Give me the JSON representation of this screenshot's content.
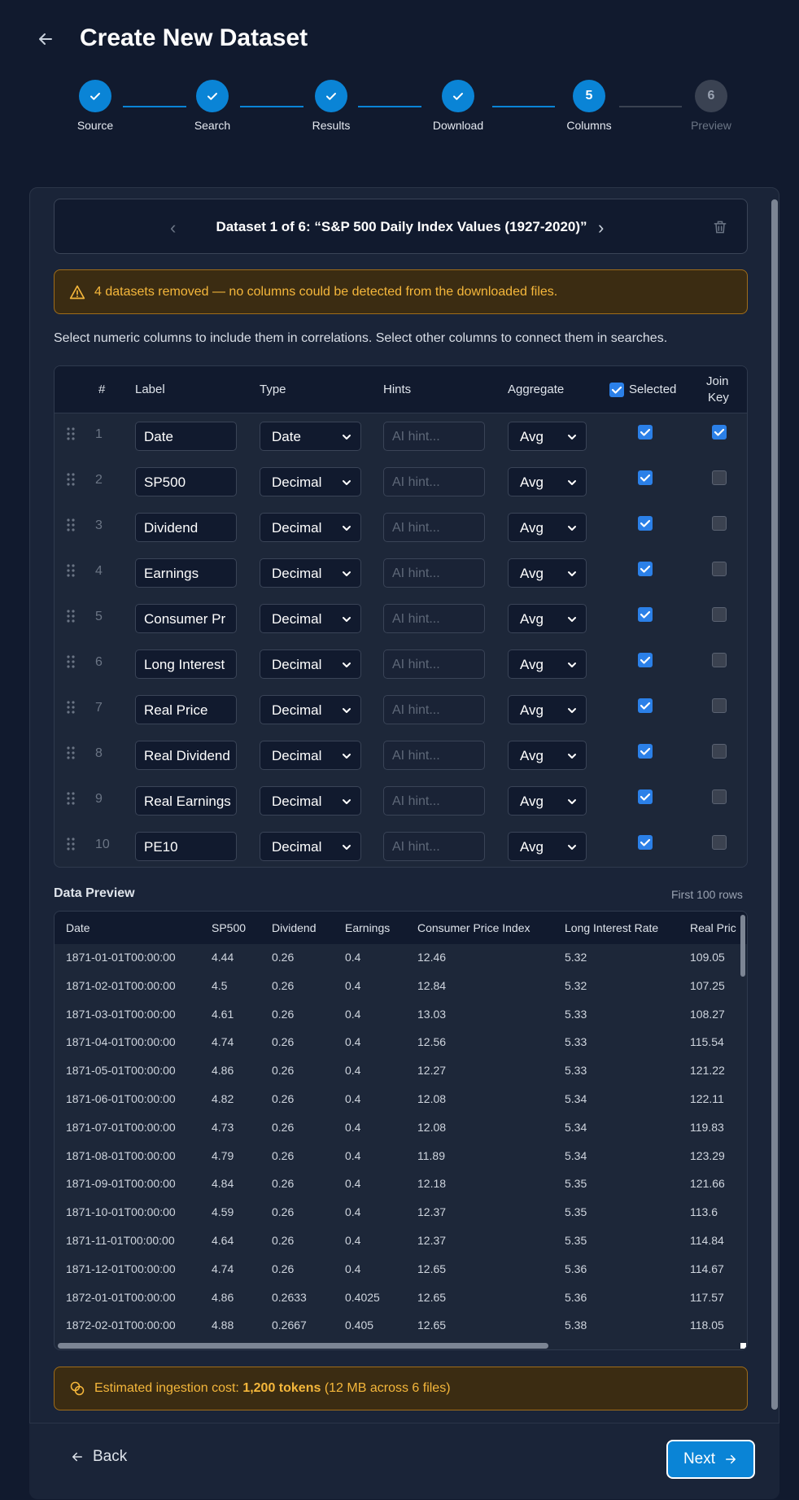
{
  "header": {
    "title": "Create New Dataset",
    "back_icon": "arrow-left-icon"
  },
  "stepper": {
    "steps": [
      {
        "label": "Source",
        "status": "done"
      },
      {
        "label": "Search",
        "status": "done"
      },
      {
        "label": "Results",
        "status": "done"
      },
      {
        "label": "Download",
        "status": "done"
      },
      {
        "label": "Columns",
        "status": "current",
        "number": "5"
      },
      {
        "label": "Preview",
        "status": "pending",
        "number": "6"
      }
    ],
    "accent": "#0a84d6"
  },
  "dataset": {
    "title": "Dataset 1 of 6: “S&P 500 Daily Index Values (1927-2020)”"
  },
  "warning": {
    "text": "4 datasets removed — no columns could be detected from the downloaded files."
  },
  "instructions": "Select numeric columns to include them in correlations. Select other columns to connect them in searches.",
  "columns_table": {
    "headers": {
      "num": "#",
      "label": "Label",
      "type": "Type",
      "hints": "Hints",
      "aggregate": "Aggregate",
      "selected": "Selected",
      "join_key_1": "Join",
      "join_key_2": "Key"
    },
    "hint_placeholder": "AI hint...",
    "rows": [
      {
        "num": "1",
        "label": "Date",
        "type": "Date",
        "agg": "Avg",
        "selected": true,
        "join": true
      },
      {
        "num": "2",
        "label": "SP500",
        "type": "Decimal",
        "agg": "Avg",
        "selected": true,
        "join": false
      },
      {
        "num": "3",
        "label": "Dividend",
        "type": "Decimal",
        "agg": "Avg",
        "selected": true,
        "join": false
      },
      {
        "num": "4",
        "label": "Earnings",
        "type": "Decimal",
        "agg": "Avg",
        "selected": true,
        "join": false
      },
      {
        "num": "5",
        "label": "Consumer Pr",
        "type": "Decimal",
        "agg": "Avg",
        "selected": true,
        "join": false
      },
      {
        "num": "6",
        "label": "Long Interest",
        "type": "Decimal",
        "agg": "Avg",
        "selected": true,
        "join": false
      },
      {
        "num": "7",
        "label": "Real Price",
        "type": "Decimal",
        "agg": "Avg",
        "selected": true,
        "join": false
      },
      {
        "num": "8",
        "label": "Real Dividend",
        "type": "Decimal",
        "agg": "Avg",
        "selected": true,
        "join": false
      },
      {
        "num": "9",
        "label": "Real Earnings",
        "type": "Decimal",
        "agg": "Avg",
        "selected": true,
        "join": false
      },
      {
        "num": "10",
        "label": "PE10",
        "type": "Decimal",
        "agg": "Avg",
        "selected": true,
        "join": false
      }
    ]
  },
  "data_preview": {
    "title": "Data Preview",
    "note": "First 100 rows",
    "headers": [
      "Date",
      "SP500",
      "Dividend",
      "Earnings",
      "Consumer Price Index",
      "Long Interest Rate",
      "Real Pric"
    ],
    "rows": [
      [
        "1871-01-01T00:00:00",
        "4.44",
        "0.26",
        "0.4",
        "12.46",
        "5.32",
        "109.05"
      ],
      [
        "1871-02-01T00:00:00",
        "4.5",
        "0.26",
        "0.4",
        "12.84",
        "5.32",
        "107.25"
      ],
      [
        "1871-03-01T00:00:00",
        "4.61",
        "0.26",
        "0.4",
        "13.03",
        "5.33",
        "108.27"
      ],
      [
        "1871-04-01T00:00:00",
        "4.74",
        "0.26",
        "0.4",
        "12.56",
        "5.33",
        "115.54"
      ],
      [
        "1871-05-01T00:00:00",
        "4.86",
        "0.26",
        "0.4",
        "12.27",
        "5.33",
        "121.22"
      ],
      [
        "1871-06-01T00:00:00",
        "4.82",
        "0.26",
        "0.4",
        "12.08",
        "5.34",
        "122.11"
      ],
      [
        "1871-07-01T00:00:00",
        "4.73",
        "0.26",
        "0.4",
        "12.08",
        "5.34",
        "119.83"
      ],
      [
        "1871-08-01T00:00:00",
        "4.79",
        "0.26",
        "0.4",
        "11.89",
        "5.34",
        "123.29"
      ],
      [
        "1871-09-01T00:00:00",
        "4.84",
        "0.26",
        "0.4",
        "12.18",
        "5.35",
        "121.66"
      ],
      [
        "1871-10-01T00:00:00",
        "4.59",
        "0.26",
        "0.4",
        "12.37",
        "5.35",
        "113.6"
      ],
      [
        "1871-11-01T00:00:00",
        "4.64",
        "0.26",
        "0.4",
        "12.37",
        "5.35",
        "114.84"
      ],
      [
        "1871-12-01T00:00:00",
        "4.74",
        "0.26",
        "0.4",
        "12.65",
        "5.36",
        "114.67"
      ],
      [
        "1872-01-01T00:00:00",
        "4.86",
        "0.2633",
        "0.4025",
        "12.65",
        "5.36",
        "117.57"
      ],
      [
        "1872-02-01T00:00:00",
        "4.88",
        "0.2667",
        "0.405",
        "12.65",
        "5.38",
        "118.05"
      ]
    ]
  },
  "cost": {
    "prefix": "Estimated ingestion cost: ",
    "tokens": "1,200 tokens",
    "suffix": " (12 MB across 6 files)"
  },
  "footer": {
    "back_label": "Back",
    "next_label": "Next"
  }
}
